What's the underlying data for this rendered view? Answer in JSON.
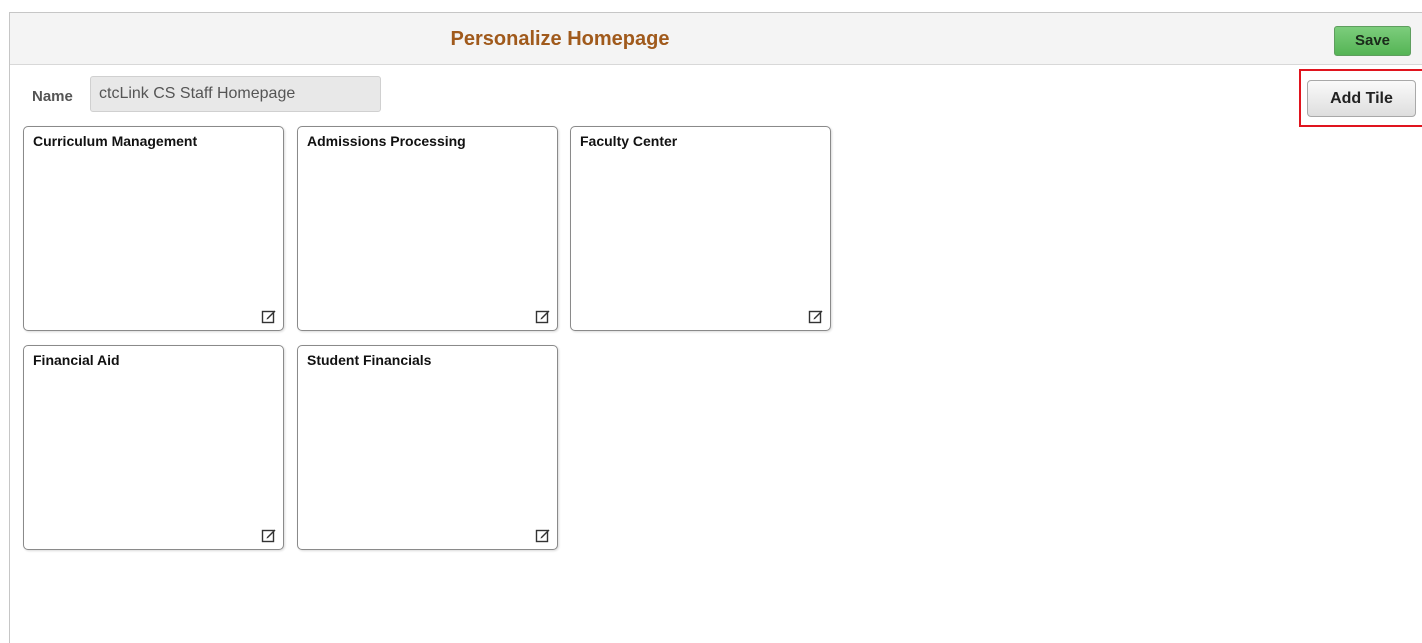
{
  "header": {
    "title": "Personalize Homepage",
    "save_label": "Save"
  },
  "name_field": {
    "label": "Name",
    "value": "ctcLink CS Staff Homepage"
  },
  "add_tile_label": "Add Tile",
  "tiles": [
    {
      "title": "Curriculum Management"
    },
    {
      "title": "Admissions Processing"
    },
    {
      "title": "Faculty Center"
    },
    {
      "title": "Financial Aid"
    },
    {
      "title": "Student Financials"
    }
  ],
  "colors": {
    "title": "#a05a1c",
    "save_button": "#55b455",
    "highlight_box": "#e0141e"
  },
  "icons": {
    "tile_edit": "edit-icon"
  }
}
